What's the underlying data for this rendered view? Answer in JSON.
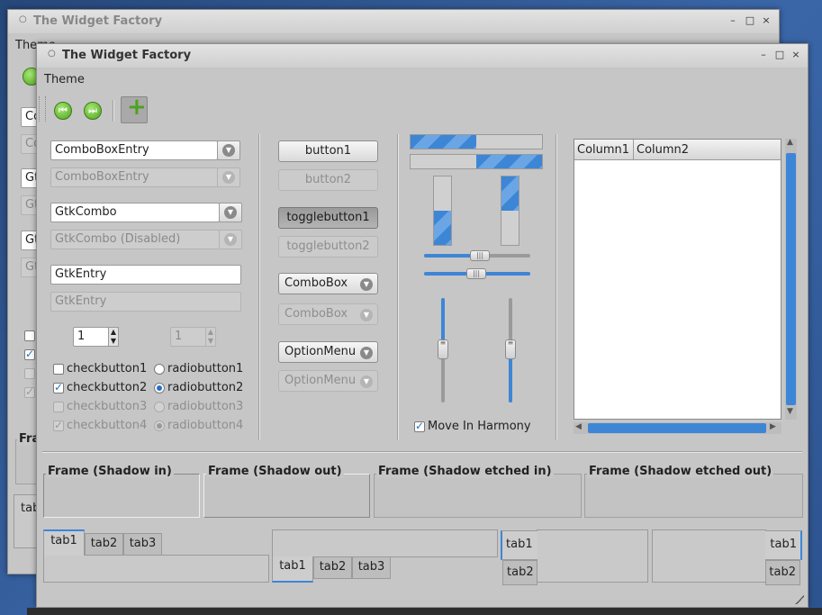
{
  "background_window": {
    "title": "The Widget Factory",
    "menu_theme": "Theme",
    "entry_stubs": [
      "Co",
      "Co",
      "Gtk",
      "Gtk",
      "Gtk",
      "Gtk"
    ],
    "frame_stub": "Fra",
    "tab_stub": "tab"
  },
  "window": {
    "title": "The Widget Factory",
    "controls": {
      "minimize": "–",
      "maximize": "□",
      "close": "×"
    }
  },
  "menubar": {
    "theme": "Theme"
  },
  "toolbar": {
    "back_icon": "go-first-icon",
    "forward_icon": "go-last-icon",
    "add_icon": "add-icon",
    "add_symbol": "+"
  },
  "left": {
    "comboboxentry": "ComboBoxEntry",
    "comboboxentry_disabled": "ComboBoxEntry",
    "gtkcombo": "GtkCombo",
    "gtkcombo_disabled": "GtkCombo (Disabled)",
    "gtkentry": "GtkEntry",
    "gtkentry_placeholder": "GtkEntry",
    "spin_value": "1",
    "spin_disabled_value": "1",
    "checks": [
      {
        "label": "checkbutton1",
        "checked": false,
        "disabled": false
      },
      {
        "label": "checkbutton2",
        "checked": true,
        "disabled": false
      },
      {
        "label": "checkbutton3",
        "checked": false,
        "disabled": true
      },
      {
        "label": "checkbutton4",
        "checked": true,
        "disabled": true
      }
    ],
    "radios": [
      {
        "label": "radiobutton1",
        "checked": false,
        "disabled": false
      },
      {
        "label": "radiobutton2",
        "checked": true,
        "disabled": false
      },
      {
        "label": "radiobutton3",
        "checked": false,
        "disabled": true
      },
      {
        "label": "radiobutton4",
        "checked": true,
        "disabled": true
      }
    ]
  },
  "middle": {
    "button1": "button1",
    "button2": "button2",
    "togglebutton1": "togglebutton1",
    "togglebutton2": "togglebutton2",
    "combobox": "ComboBox",
    "combobox_disabled": "ComboBox",
    "optionmenu": "OptionMenu",
    "optionmenu_disabled": "OptionMenu"
  },
  "right": {
    "progress_h1": 0.5,
    "progress_h2": 0.5,
    "progress_v1": 0.5,
    "progress_v2": 0.5,
    "scale_h1": 0.5,
    "scale_h2": 0.5,
    "scale_v1": 0.5,
    "scale_v2": 0.5,
    "move_in_harmony": "Move In Harmony",
    "move_in_harmony_checked": true
  },
  "treeview": {
    "columns": [
      "Column1",
      "Column2"
    ],
    "scroll_up": "▲",
    "scroll_down": "▼",
    "scroll_left": "◀",
    "scroll_right": "▶"
  },
  "frames": [
    "Frame (Shadow in)",
    "Frame (Shadow out)",
    "Frame (Shadow etched in)",
    "Frame (Shadow etched out)"
  ],
  "notebooks": {
    "top": [
      "tab1",
      "tab2",
      "tab3"
    ],
    "bottom": [
      "tab1",
      "tab2",
      "tab3"
    ],
    "left": [
      "tab1",
      "tab2"
    ],
    "right": [
      "tab1",
      "tab2"
    ]
  },
  "colors": {
    "accent": "#3d86d6",
    "window_bg": "#c6c6c6",
    "desktop": "#2a4f86"
  }
}
